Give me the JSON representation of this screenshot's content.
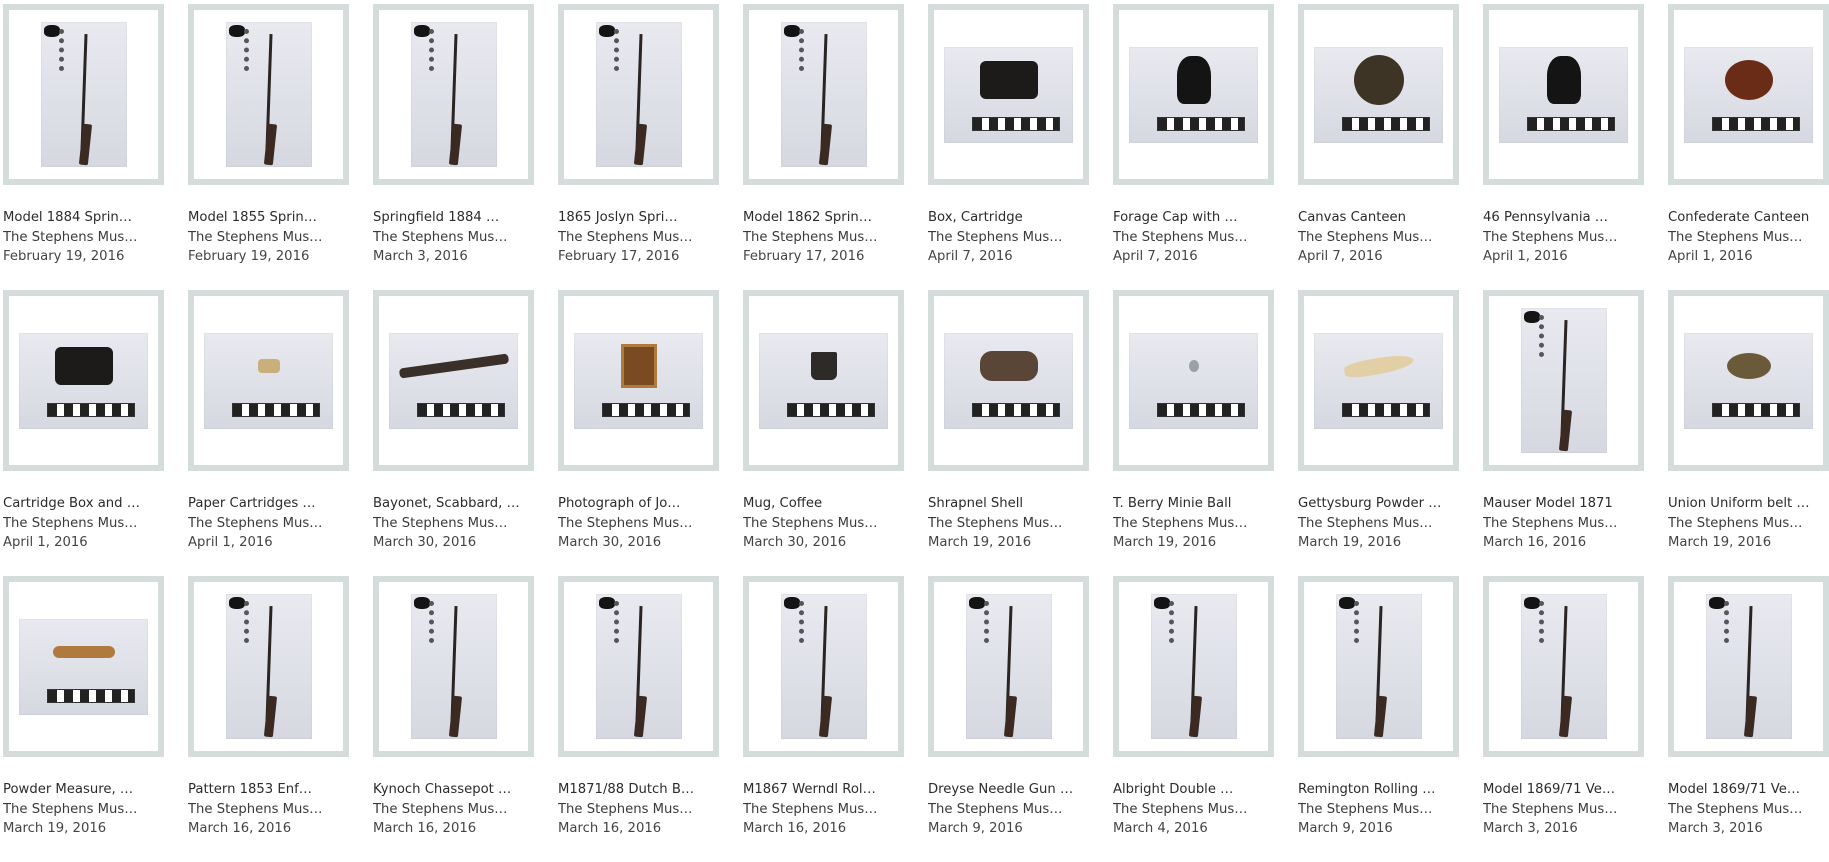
{
  "items": [
    {
      "title": "Model 1884 Sprin…",
      "source": "The Stephens Mus…",
      "date": "February 19, 2016",
      "thumb": "tall",
      "kind": "rifle"
    },
    {
      "title": "Model 1855 Sprin…",
      "source": "The Stephens Mus…",
      "date": "February 19, 2016",
      "thumb": "tall",
      "kind": "rifle"
    },
    {
      "title": "Springfield 1884 …",
      "source": "The Stephens Mus…",
      "date": "March 3, 2016",
      "thumb": "tall",
      "kind": "rifle"
    },
    {
      "title": "1865 Joslyn Spri…",
      "source": "The Stephens Mus…",
      "date": "February 17, 2016",
      "thumb": "tall",
      "kind": "rifle"
    },
    {
      "title": "Model 1862 Sprin…",
      "source": "The Stephens Mus…",
      "date": "February 17, 2016",
      "thumb": "tall",
      "kind": "rifle"
    },
    {
      "title": "Box, Cartridge",
      "source": "The Stephens Mus…",
      "date": "April 7, 2016",
      "thumb": "wide",
      "kind": "box"
    },
    {
      "title": "Forage Cap with …",
      "source": "The Stephens Mus…",
      "date": "April 7, 2016",
      "thumb": "wide",
      "kind": "cap"
    },
    {
      "title": "Canvas Canteen",
      "source": "The Stephens Mus…",
      "date": "April 7, 2016",
      "thumb": "wide",
      "kind": "canteen"
    },
    {
      "title": "46 Pennsylvania …",
      "source": "The Stephens Mus…",
      "date": "April 1, 2016",
      "thumb": "wide",
      "kind": "cap"
    },
    {
      "title": "Confederate Canteen",
      "source": "The Stephens Mus…",
      "date": "April 1, 2016",
      "thumb": "wide",
      "kind": "canteen-red"
    },
    {
      "title": "Cartridge Box and …",
      "source": "The Stephens Mus…",
      "date": "April 1, 2016",
      "thumb": "wide",
      "kind": "box"
    },
    {
      "title": "Paper Cartridges …",
      "source": "The Stephens Mus…",
      "date": "April 1, 2016",
      "thumb": "wide",
      "kind": "small"
    },
    {
      "title": "Bayonet, Scabbard, …",
      "source": "The Stephens Mus…",
      "date": "March 30, 2016",
      "thumb": "wide",
      "kind": "bayonet"
    },
    {
      "title": "Photograph of Jo…",
      "source": "The Stephens Mus…",
      "date": "March 30, 2016",
      "thumb": "wide",
      "kind": "photo"
    },
    {
      "title": "Mug, Coffee",
      "source": "The Stephens Mus…",
      "date": "March 30, 2016",
      "thumb": "wide",
      "kind": "mug"
    },
    {
      "title": "Shrapnel Shell",
      "source": "The Stephens Mus…",
      "date": "March 19, 2016",
      "thumb": "wide",
      "kind": "shell"
    },
    {
      "title": "T. Berry Minie Ball",
      "source": "The Stephens Mus…",
      "date": "March 19, 2016",
      "thumb": "wide",
      "kind": "ball"
    },
    {
      "title": "Gettysburg Powder …",
      "source": "The Stephens Mus…",
      "date": "March 19, 2016",
      "thumb": "wide",
      "kind": "horn"
    },
    {
      "title": "Mauser Model 1871",
      "source": "The Stephens Mus…",
      "date": "March 16, 2016",
      "thumb": "tall",
      "kind": "rifle"
    },
    {
      "title": "Union Uniform belt …",
      "source": "The Stephens Mus…",
      "date": "March 19, 2016",
      "thumb": "wide",
      "kind": "buckle"
    },
    {
      "title": "Powder Measure, …",
      "source": "The Stephens Mus…",
      "date": "March 19, 2016",
      "thumb": "wide",
      "kind": "measure"
    },
    {
      "title": "Pattern 1853 Enf…",
      "source": "The Stephens Mus…",
      "date": "March 16, 2016",
      "thumb": "tall",
      "kind": "rifle"
    },
    {
      "title": "Kynoch Chassepot …",
      "source": "The Stephens Mus…",
      "date": "March 16, 2016",
      "thumb": "tall",
      "kind": "rifle"
    },
    {
      "title": "M1871/88 Dutch B…",
      "source": "The Stephens Mus…",
      "date": "March 16, 2016",
      "thumb": "tall",
      "kind": "rifle"
    },
    {
      "title": "M1867 Werndl Rol…",
      "source": "The Stephens Mus…",
      "date": "March 16, 2016",
      "thumb": "tall",
      "kind": "rifle"
    },
    {
      "title": "Dreyse Needle Gun …",
      "source": "The Stephens Mus…",
      "date": "March 9, 2016",
      "thumb": "tall",
      "kind": "rifle"
    },
    {
      "title": "Albright Double …",
      "source": "The Stephens Mus…",
      "date": "March 4, 2016",
      "thumb": "tall",
      "kind": "rifle"
    },
    {
      "title": "Remington Rolling …",
      "source": "The Stephens Mus…",
      "date": "March 9, 2016",
      "thumb": "tall",
      "kind": "rifle"
    },
    {
      "title": "Model 1869/71 Ve…",
      "source": "The Stephens Mus…",
      "date": "March 3, 2016",
      "thumb": "tall",
      "kind": "rifle"
    },
    {
      "title": "Model 1869/71 Ve…",
      "source": "The Stephens Mus…",
      "date": "March 3, 2016",
      "thumb": "tall",
      "kind": "rifle"
    }
  ],
  "colors": {
    "frame": "#d5dcdc",
    "text": "#3a3a3a",
    "background": "#ffffff"
  }
}
